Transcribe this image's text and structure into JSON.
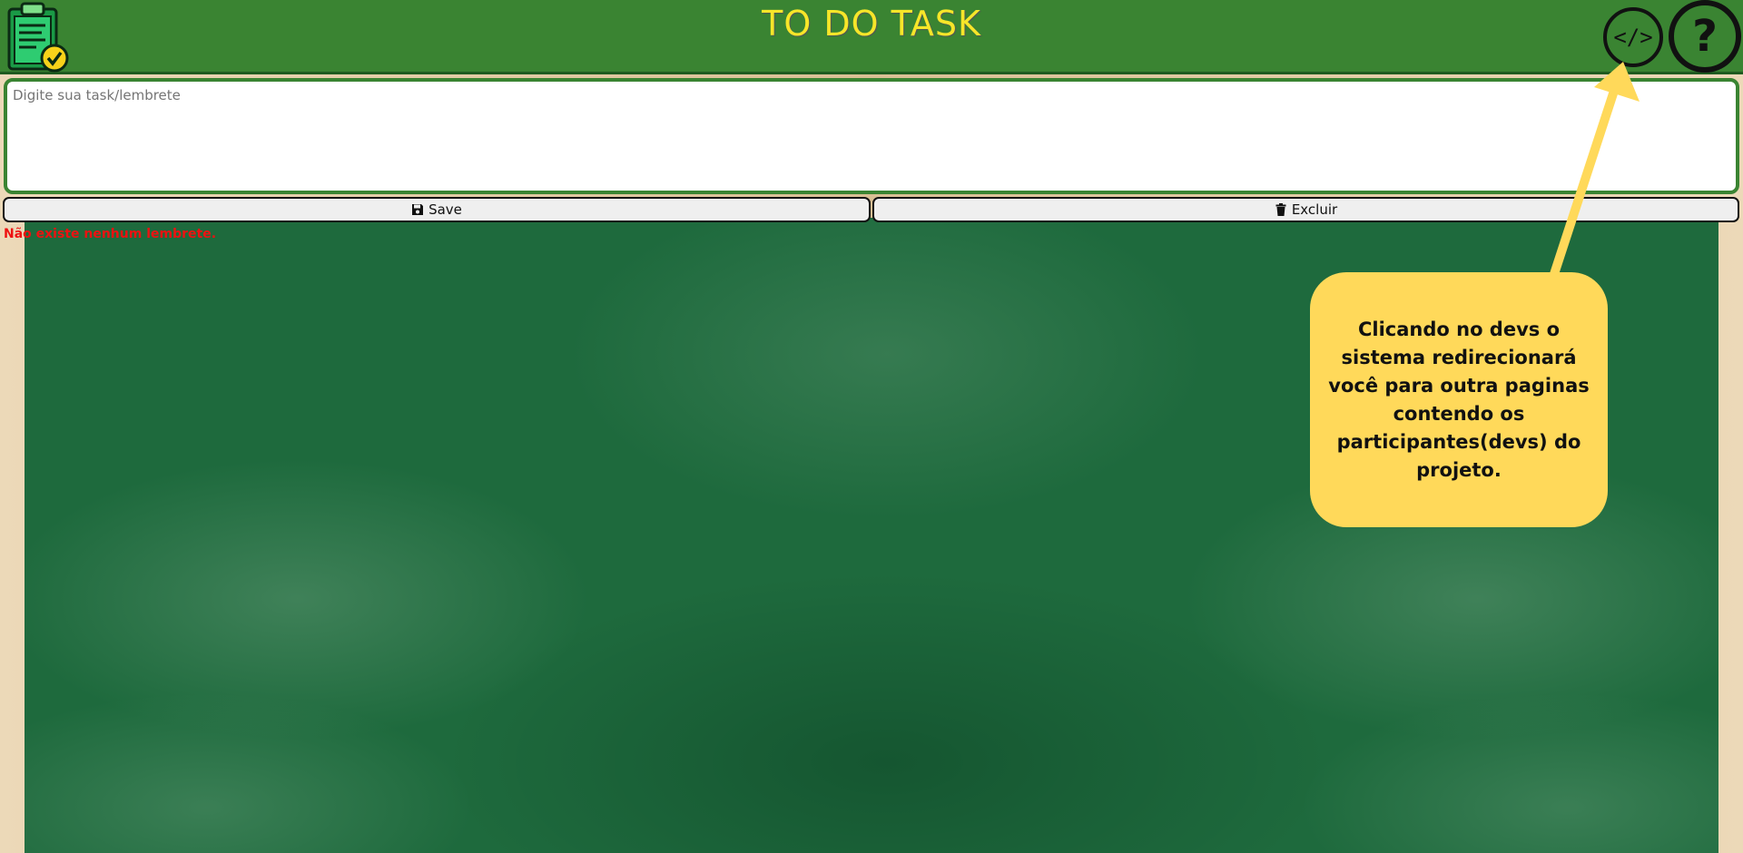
{
  "header": {
    "title": "TO DO TASK",
    "logo_icon": "clipboard-check-icon",
    "devs_label": "</>",
    "devs_icon": "code-icon",
    "help_label": "?",
    "help_icon": "question-icon",
    "background_color": "#3a8432",
    "title_color": "#f7e629"
  },
  "task_input": {
    "placeholder": "Digite sua task/lembrete",
    "value": ""
  },
  "actions": {
    "save_label": "Save",
    "save_icon": "floppy-disk-icon",
    "delete_label": "Excluir",
    "delete_icon": "trash-icon"
  },
  "status": {
    "empty_message": "Não existe nenhum lembrete.",
    "color": "#e11111"
  },
  "tooltip": {
    "text": "Clicando no devs o sistema redirecionará você para outra paginas contendo os participantes(devs) do projeto.",
    "color": "#ffd95a"
  }
}
